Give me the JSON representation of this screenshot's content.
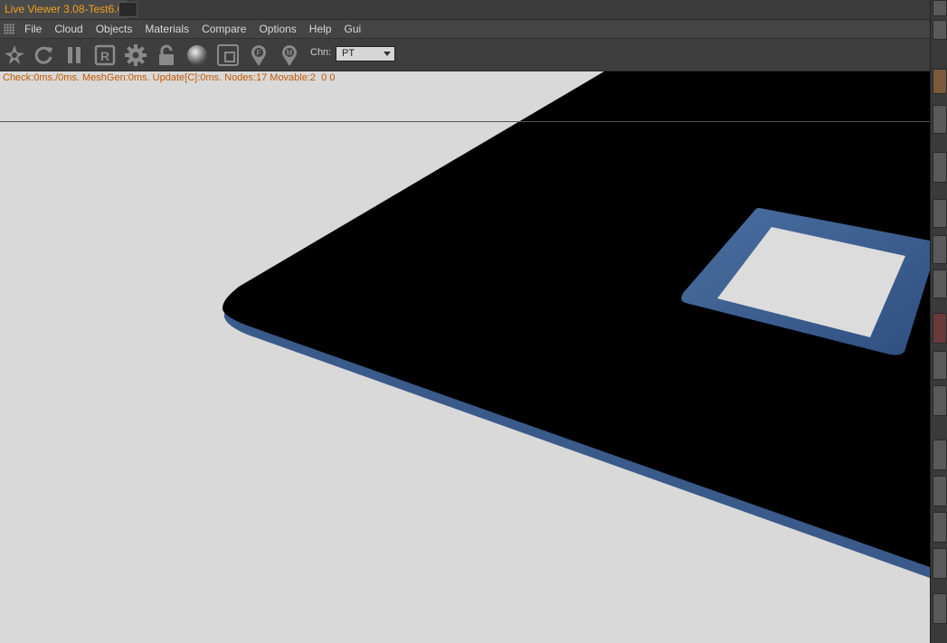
{
  "window": {
    "tab_title": "Live Viewer 3.08-Test6.0"
  },
  "menu": {
    "items": [
      "File",
      "Cloud",
      "Objects",
      "Materials",
      "Compare",
      "Options",
      "Help",
      "Gui"
    ]
  },
  "toolbar": {
    "icons": [
      "octane-logo-icon",
      "refresh-icon",
      "pause-icon",
      "region-r-icon",
      "settings-gear-icon",
      "lock-icon",
      "material-sphere-icon",
      "render-region-icon",
      "focus-pin-icon",
      "material-pin-icon"
    ],
    "channel_label": "Chn:",
    "channel_value": "PT"
  },
  "viewport": {
    "status_text": "Check:0ms./0ms. MeshGen:0ms. Update[C]:0ms. Nodes:17 Movable:2  0 0"
  },
  "colors": {
    "tab_title": "#f0a020",
    "status_text": "#c25a00",
    "viewport_bg": "#d9d9d9",
    "panel_edge": "#3a5a8a"
  }
}
